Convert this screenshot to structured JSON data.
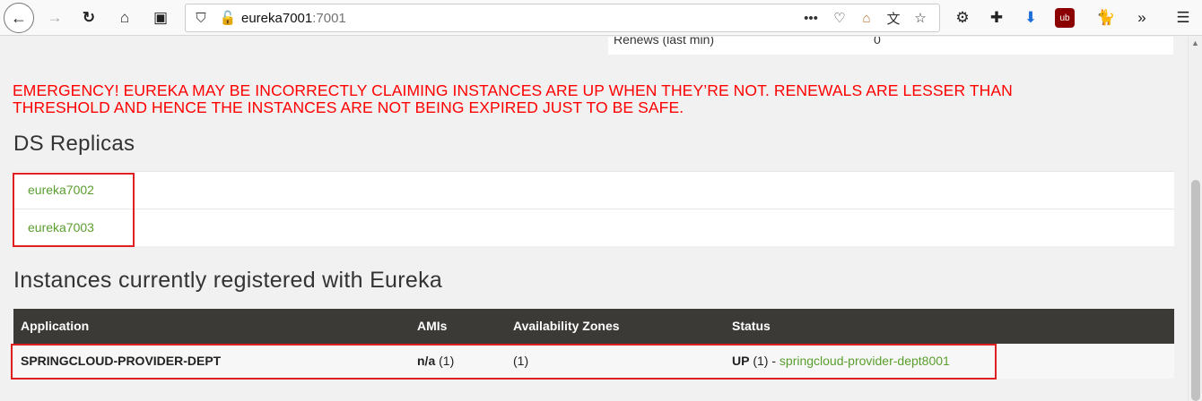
{
  "browser": {
    "url_host": "eureka7001",
    "url_port": ":7001"
  },
  "stats": {
    "renews_label": "Renews (last min)",
    "renews_value": "0"
  },
  "emergency_line1": "EMERGENCY! EUREKA MAY BE INCORRECTLY CLAIMING INSTANCES ARE UP WHEN THEY’RE NOT. RENEWALS ARE LESSER THAN",
  "emergency_line2": "THRESHOLD AND HENCE THE INSTANCES ARE NOT BEING EXPIRED JUST TO BE SAFE.",
  "replicas": {
    "title": "DS Replicas",
    "items": [
      "eureka7002",
      "eureka7003"
    ]
  },
  "instances": {
    "title": "Instances currently registered with Eureka",
    "columns": [
      "Application",
      "AMIs",
      "Availability Zones",
      "Status"
    ],
    "rows": [
      {
        "application": "SPRINGCLOUD-PROVIDER-DEPT",
        "amis_value": "n/a",
        "amis_count": "(1)",
        "zones": "(1)",
        "status_state": "UP",
        "status_count": "(1) -",
        "status_link": "springcloud-provider-dept8001"
      }
    ]
  },
  "colors": {
    "emergency": "#ff0000",
    "link": "#5a9e2e",
    "table_header": "#3b3a36",
    "highlight_box": "#e02020"
  }
}
